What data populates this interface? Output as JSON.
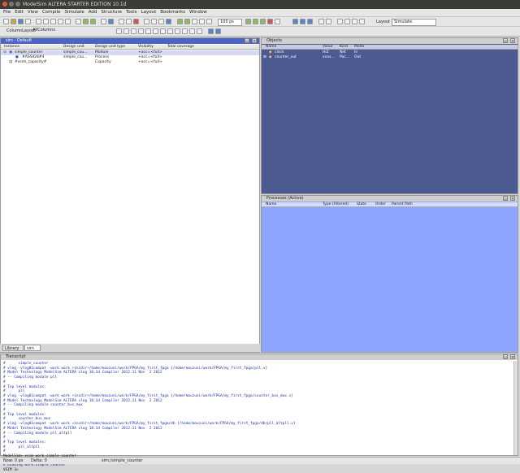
{
  "window": {
    "title": "ModelSim ALTERA STARTER EDITION 10.1d"
  },
  "menu": [
    "File",
    "Edit",
    "View",
    "Compile",
    "Simulate",
    "Add",
    "Structure",
    "Tools",
    "Layout",
    "Bookmarks",
    "Window"
  ],
  "toolbar": {
    "time_value": "100 ps",
    "layout_label": "Layout",
    "layout_value": "Simulate",
    "column_layout_label": "ColumnLayout",
    "column_layout_value": "AllColumns"
  },
  "sim_pane": {
    "title": "sim - Default",
    "columns": [
      "Instance",
      "Design unit",
      "Design unit type",
      "Visibility",
      "Total coverage"
    ],
    "rows": [
      {
        "name": "simple_counter",
        "unit": "simple_cou...",
        "type": "Module",
        "visibility": "+acc=<full>",
        "coverage": ""
      },
      {
        "name": "#ASSIGN#4",
        "unit": "simple_cou...",
        "type": "Process",
        "visibility": "+acc=<full>",
        "coverage": ""
      },
      {
        "name": "#vsim_capacity#",
        "unit": "",
        "type": "Capacity",
        "visibility": "+acc=<full>",
        "coverage": ""
      }
    ],
    "tabs": [
      "Library",
      "sim"
    ]
  },
  "objects_pane": {
    "title": "Objects",
    "columns": [
      "Name",
      "Value",
      "Kind",
      "Mode"
    ],
    "rows": [
      {
        "name": "clock",
        "value": "HiZ",
        "kind": "Net",
        "mode": "In"
      },
      {
        "name": "counter_out",
        "value": "xxxx...",
        "kind": "Pac...",
        "mode": "Out"
      }
    ]
  },
  "processes_pane": {
    "title": "Processes (Active)",
    "columns": [
      "Name",
      "Type (Filtered)",
      "State",
      "Order",
      "Parent Path"
    ]
  },
  "transcript": {
    "title": "Transcript",
    "lines": [
      "#      simple_counter",
      "# vlog -vlog01compat -work work +incdir+/home/mouzuni/work/FPGA/my_first_fpga {/home/mouzuni/work/FPGA/my_first_fpga/pll.v}",
      "# Model Technology ModelSim ALTERA vlog 10.1d Compiler 2012.11 Nov  2 2012",
      "# -- Compiling module pll",
      "#",
      "# Top level modules:",
      "#      pll",
      "# vlog -vlog01compat -work work +incdir+/home/mouzuni/work/FPGA/my_first_fpga {/home/mouzuni/work/FPGA/my_first_fpga/counter_bus_mux.v}",
      "# Model Technology ModelSim ALTERA vlog 10.1d Compiler 2012.11 Nov  2 2012",
      "# -- Compiling module counter_bus_mux",
      "#",
      "# Top level modules:",
      "#      counter_bus_mux",
      "# vlog -vlog01compat -work work +incdir+/home/mouzuni/work/FPGA/my_first_fpga/db {/home/mouzuni/work/FPGA/my_first_fpga/db/pll_altpll.v}",
      "# Model Technology ModelSim ALTERA vlog 10.1d Compiler 2012.11 Nov  2 2012",
      "# -- Compiling module pll_altpll",
      "#",
      "# Top level modules:",
      "#      pll_altpll",
      "#",
      "ModelSim> vsim work.simple_counter",
      "# vsim work.simple_counter",
      "# Loading work.simple_counter",
      "",
      "VSIM 3>"
    ]
  },
  "status": {
    "now": "Now: 0 ps",
    "delta": "Delta: 0",
    "path": "sim:/simple_counter"
  },
  "colors": {
    "objects_bg": "#4c5a91",
    "processes_bg": "#8da5ff",
    "active_title": "#4a64c8"
  }
}
